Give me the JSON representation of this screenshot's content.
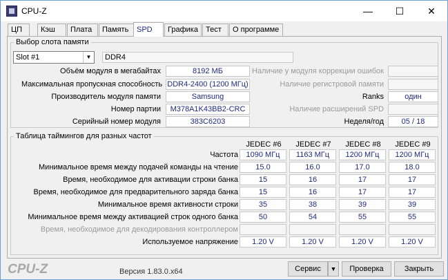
{
  "window": {
    "title": "CPU-Z",
    "minimize": "—",
    "maximize": "☐",
    "close": "✕"
  },
  "tabs": [
    "ЦП",
    "Кэш",
    "Плата",
    "Память",
    "SPD",
    "Графика",
    "Тест",
    "О программе"
  ],
  "active_tab": "SPD",
  "slot": {
    "legend": "Выбор слота памяти",
    "selected": "Slot #1",
    "type": "DDR4",
    "left_rows": [
      {
        "label": "Объём модуля в мегабайтах",
        "value": "8192 МБ"
      },
      {
        "label": "Максимальная пропускная способность",
        "value": "DDR4-2400 (1200 МГц)"
      },
      {
        "label": "Производитель модуля памяти",
        "value": "Samsung"
      },
      {
        "label": "Номер партии",
        "value": "M378A1K43BB2-CRC"
      },
      {
        "label": "Серийный номер модуля",
        "value": "383C6203"
      }
    ],
    "right_rows": [
      {
        "label": "Наличие у модуля коррекции ошибок",
        "value": "",
        "disabled": true
      },
      {
        "label": "Наличие регистровой памяти",
        "value": "",
        "disabled": true
      },
      {
        "label": "Ranks",
        "value": "один",
        "disabled": false
      },
      {
        "label": "Наличие расширений SPD",
        "value": "",
        "disabled": true
      },
      {
        "label": "Неделя/год",
        "value": "05 / 18",
        "disabled": false
      }
    ]
  },
  "timings": {
    "legend": "Таблица таймингов для разных частот",
    "columns": [
      "JEDEC #6",
      "JEDEC #7",
      "JEDEC #8",
      "JEDEC #9"
    ],
    "rows": [
      {
        "label": "Частота",
        "values": [
          "1090 МГц",
          "1163 МГц",
          "1200 МГц",
          "1200 МГц"
        ],
        "disabled": false
      },
      {
        "label": "Минимальное время между подачей команды на чтение",
        "values": [
          "15.0",
          "16.0",
          "17.0",
          "18.0"
        ],
        "disabled": false
      },
      {
        "label": "Время, необходимое для активации строки банка",
        "values": [
          "15",
          "16",
          "17",
          "17"
        ],
        "disabled": false
      },
      {
        "label": "Время, необходимое для предварительного заряда банка",
        "values": [
          "15",
          "16",
          "17",
          "17"
        ],
        "disabled": false
      },
      {
        "label": "Минимальное время активности строки",
        "values": [
          "35",
          "38",
          "39",
          "39"
        ],
        "disabled": false
      },
      {
        "label": "Минимальное время между активацией строк одного банка",
        "values": [
          "50",
          "54",
          "55",
          "55"
        ],
        "disabled": false
      },
      {
        "label": "Время, необходимое для декодирования контроллером",
        "values": [
          "",
          "",
          "",
          ""
        ],
        "disabled": true
      },
      {
        "label": "Используемое напряжение",
        "values": [
          "1.20 V",
          "1.20 V",
          "1.20 V",
          "1.20 V"
        ],
        "disabled": false
      }
    ]
  },
  "footer": {
    "logo": "CPU-Z",
    "version": "Версия 1.83.0.x64",
    "service_button": "Сервис",
    "service_arrow": "▼",
    "check_button": "Проверка",
    "close_button": "Закрыть"
  },
  "colors": {
    "value_text": "#1f2a80",
    "disabled_text": "#9a9a9a"
  }
}
